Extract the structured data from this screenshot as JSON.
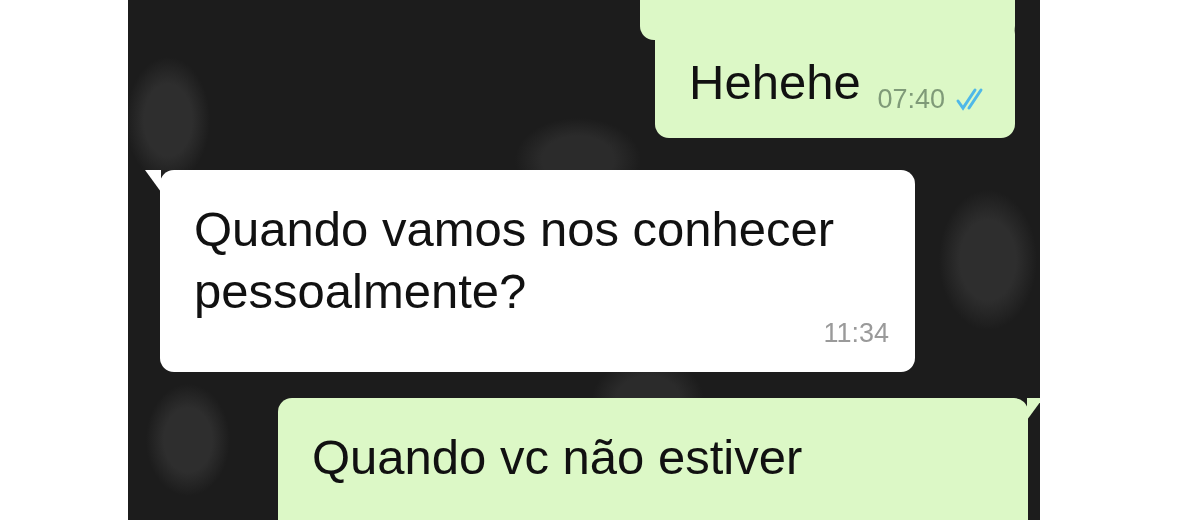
{
  "messages": [
    {
      "kind": "outgoing"
    },
    {
      "kind": "outgoing",
      "text": "Hehehe",
      "time": "07:40",
      "read": true
    },
    {
      "kind": "incoming",
      "text": "Quando vamos nos conhecer pessoalmente?",
      "time": "11:34"
    },
    {
      "kind": "outgoing",
      "text": "Quando vc não estiver"
    }
  ]
}
